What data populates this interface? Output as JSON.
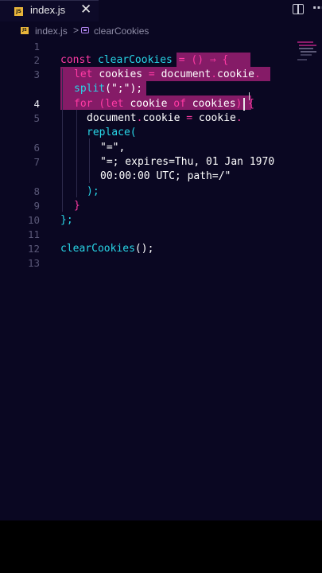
{
  "tab": {
    "label": "index.js",
    "close": "✕",
    "js_badge": "JS"
  },
  "breadcrumb": {
    "file": "index.js",
    "separator": ">",
    "symbol": "clearCookies"
  },
  "line_numbers": [
    "1",
    "2",
    "3",
    "",
    "4",
    "5",
    "",
    "6",
    "7",
    "",
    "8",
    "9",
    "10",
    "11",
    "12",
    "13"
  ],
  "active_line": "4",
  "code_lines": [
    {
      "tokens": [
        {
          "t": "const ",
          "c": "kw"
        },
        {
          "t": "clearCookies",
          "c": "fn"
        },
        {
          "t": " = () ",
          "c": "kw"
        },
        {
          "t": "⇒",
          "c": "kw"
        },
        {
          "t": " {",
          "c": "kw"
        }
      ]
    },
    {
      "tokens": [
        {
          "t": "let ",
          "c": "kw"
        },
        {
          "t": "cookies",
          "c": "id"
        },
        {
          "t": " = ",
          "c": "kw"
        },
        {
          "t": "document",
          "c": "id"
        },
        {
          "t": ".",
          "c": "kw"
        },
        {
          "t": "cookie",
          "c": "id"
        },
        {
          "t": ".",
          "c": "kw"
        }
      ]
    },
    {
      "tokens": [
        {
          "t": "split",
          "c": "fn"
        },
        {
          "t": "(\";\");",
          "c": "str"
        }
      ]
    },
    {
      "tokens": [
        {
          "t": "for ",
          "c": "kw"
        },
        {
          "t": "(",
          "c": "kw"
        },
        {
          "t": "let ",
          "c": "kw"
        },
        {
          "t": "cookie ",
          "c": "id"
        },
        {
          "t": "of ",
          "c": "kw"
        },
        {
          "t": "cookies",
          "c": "id"
        },
        {
          "t": ") {",
          "c": "kw"
        }
      ]
    },
    {
      "tokens": [
        {
          "t": "document",
          "c": "id"
        },
        {
          "t": ".",
          "c": "kw"
        },
        {
          "t": "cookie",
          "c": "id"
        },
        {
          "t": " = ",
          "c": "kw"
        },
        {
          "t": "cookie",
          "c": "id"
        },
        {
          "t": ".",
          "c": "kw"
        }
      ]
    },
    {
      "tokens": [
        {
          "t": "replace",
          "c": "fn"
        },
        {
          "t": "(",
          "c": "fn"
        }
      ]
    },
    {
      "tokens": [
        {
          "t": "\"=\",",
          "c": "str"
        }
      ]
    },
    {
      "tokens": [
        {
          "t": "\"=; expires=Thu, 01 Jan 1970",
          "c": "str"
        }
      ]
    },
    {
      "tokens": [
        {
          "t": "00:00:00 UTC; path=/\"",
          "c": "str"
        }
      ]
    },
    {
      "tokens": [
        {
          "t": ");",
          "c": "fn"
        }
      ]
    },
    {
      "tokens": [
        {
          "t": "}",
          "c": "kw"
        }
      ]
    },
    {
      "tokens": [
        {
          "t": "};",
          "c": "fn"
        }
      ]
    },
    {
      "tokens": [
        {
          "t": "clearCookies",
          "c": "fn"
        },
        {
          "t": "();",
          "c": "str"
        }
      ]
    }
  ],
  "colors": {
    "background": "#0a0722",
    "keyword": "#ff3aa4",
    "function": "#28d7e8",
    "selection": "#8c1c6b"
  },
  "icons": [
    "js-file-icon",
    "close-icon",
    "split-editor-icon",
    "more-actions-icon",
    "symbol-function-icon"
  ]
}
